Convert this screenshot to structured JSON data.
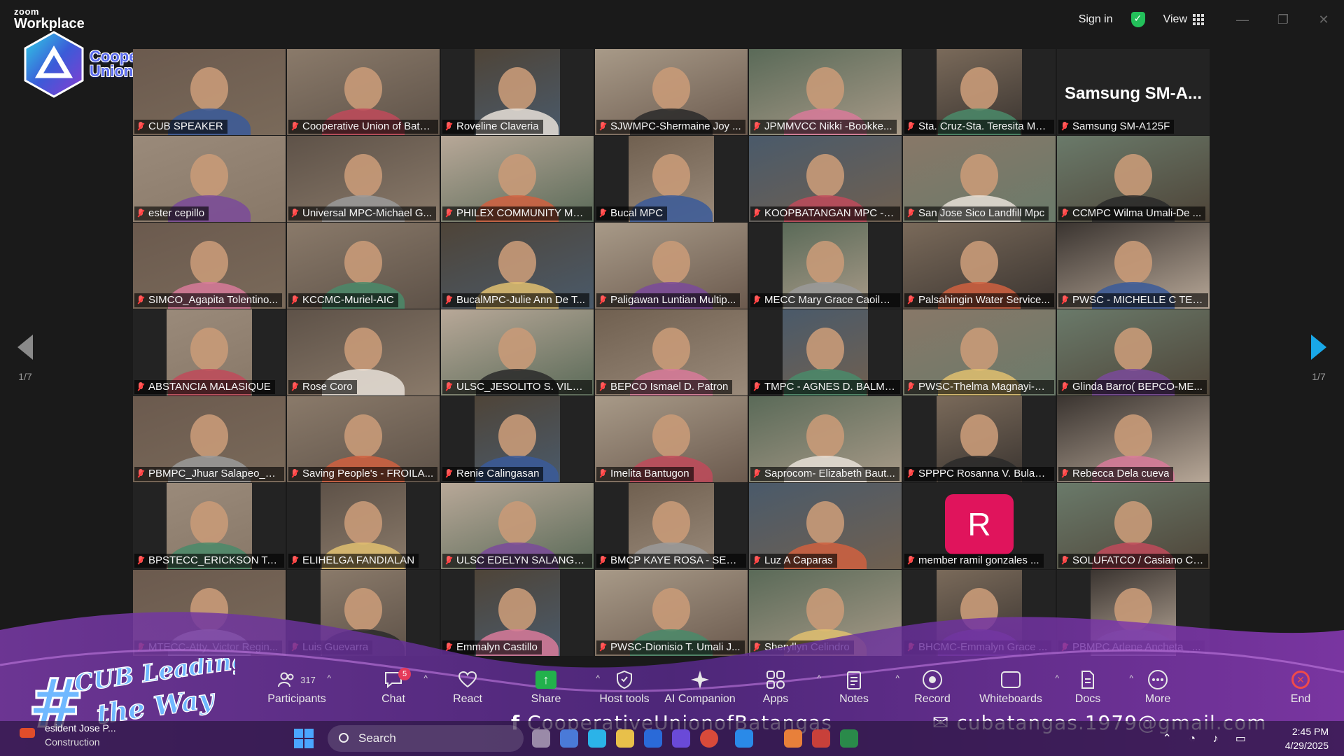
{
  "app": {
    "brand_small": "zoom",
    "brand_big": "Workplace"
  },
  "titlebar": {
    "sign_in": "Sign in",
    "view": "View"
  },
  "org": {
    "line1": "Cooperative",
    "line2": "Union of Batangas"
  },
  "pager": {
    "left": "1/7",
    "right": "1/7"
  },
  "participants": [
    "CUB SPEAKER",
    "Cooperative Union of Batang...",
    "Roveline Claveria",
    "SJWMPC-Shermaine Joy ...",
    "JPMMVCC Nikki -Bookke...",
    "Sta. Cruz-Sta. Teresita MPC",
    "Samsung SM-A125F",
    "ester cepillo",
    "Universal MPC-Michael G...",
    "PHILEX COMMUNITY MU...",
    "Bucal MPC",
    "KOOPBATANGAN MPC -V...",
    "San Jose Sico Landfill Mpc",
    "CCMPC Wilma Umali-De ...",
    "SIMCO_Agapita Tolentino...",
    "KCCMC-Muriel-AIC",
    "BucalMPC-Julie Ann De T...",
    "Paligawan Luntian Multip...",
    "MECC Mary Grace Caoile ...",
    "Palsahingin Water Service...",
    "PWSC - MICHELLE C TEÑ...",
    "ABSTANCIA MALASIQUE",
    "Rose Coro",
    "ULSC_JESOLITO S. VILLA...",
    "BEPCO Ismael D. Patron",
    "TMPC - AGNES D. BALME...",
    "PWSC-Thelma Magnayi-B...",
    "Glinda Barro( BEPCO-ME...",
    "PBMPC_Jhuar Salapeo_B...",
    "Saving People's - FROILA...",
    "Renie Calingasan",
    "Imelita Bantugon",
    "Saprocom- Elizabeth Baut...",
    "SPPPC Rosanna V. Bulan (...",
    "Rebecca Dela cueva",
    "BPSTECC_ERICKSON T. G...",
    "ELIHELGA FANDIALAN",
    "ULSC EDELYN SALANGUI...",
    "BMCP KAYE ROSA - SECR...",
    "Luz A Caparas",
    "member ramil gonzales ...",
    "SOLUFATCO / Casiano CA...",
    "MTECC-Atty. Victor Regin...",
    "Luis Guevarra",
    "Emmalyn Castillo",
    "PWSC-Dionisio T. Umali J...",
    "Sheryllyn Celindro",
    "BHCMC-Emmalyn Grace ...",
    "PBMPC Arlene Ancheta_ ..."
  ],
  "special_tiles": {
    "samsung_name": "Samsung SM-A...",
    "avatar_letter": "R"
  },
  "toolbar": {
    "participants": "Participants",
    "participants_count": "317",
    "chat": "Chat",
    "chat_badge": "5",
    "react": "React",
    "share": "Share",
    "host_tools": "Host tools",
    "ai_companion": "AI Companion",
    "apps": "Apps",
    "notes": "Notes",
    "record": "Record",
    "whiteboards": "Whiteboards",
    "docs": "Docs",
    "more": "More",
    "end": "End"
  },
  "promo": {
    "facebook": "CooperativeUnionofBatangas",
    "email": "cubatangas.1979@gmail.com"
  },
  "overlay_hashtag": "#CUB Leading the Way",
  "taskbar": {
    "weather_line1": "esident Jose P...",
    "weather_line2": "Construction",
    "search": "Search",
    "time": "2:45 PM",
    "date": "4/29/2025"
  },
  "colors": {
    "active_speaker": "#2ad26b",
    "share": "#22b14c",
    "end": "#f04a4a",
    "accent_arrow": "#19a8e8"
  }
}
